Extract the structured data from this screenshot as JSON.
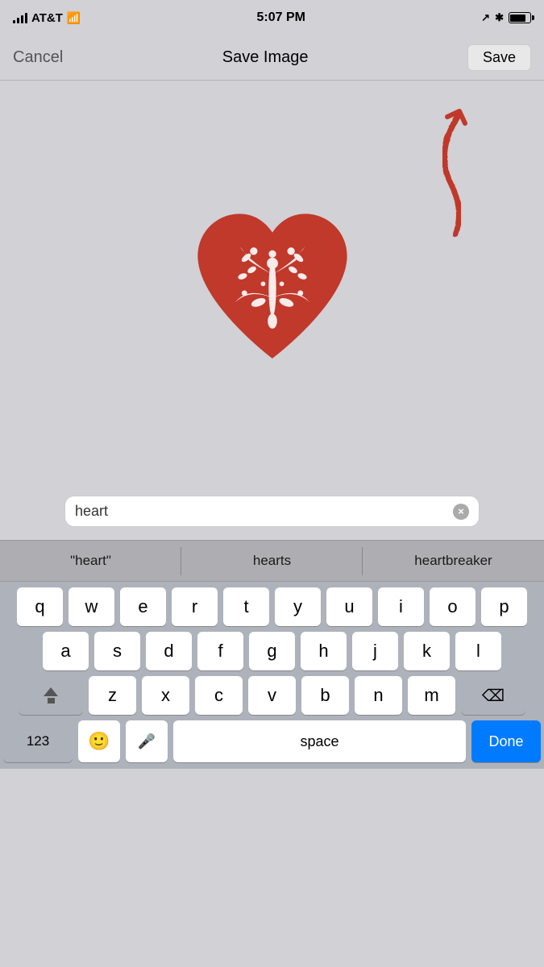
{
  "status_bar": {
    "carrier": "AT&T",
    "time": "5:07 PM",
    "icons": {
      "signal": "signal",
      "wifi": "wifi",
      "location": "location",
      "bluetooth": "bluetooth",
      "battery": "battery"
    }
  },
  "nav_bar": {
    "cancel_label": "Cancel",
    "title": "Save Image",
    "save_label": "Save"
  },
  "search": {
    "value": "heart",
    "clear_label": "×"
  },
  "suggestions": [
    {
      "id": "exact",
      "text": "\"heart\""
    },
    {
      "id": "hearts",
      "text": "hearts"
    },
    {
      "id": "heartbreaker",
      "text": "heartbreaker"
    }
  ],
  "keyboard": {
    "rows": [
      [
        "q",
        "w",
        "e",
        "r",
        "t",
        "y",
        "u",
        "i",
        "o",
        "p"
      ],
      [
        "a",
        "s",
        "d",
        "f",
        "g",
        "h",
        "j",
        "k",
        "l"
      ],
      [
        "z",
        "x",
        "c",
        "v",
        "b",
        "n",
        "m"
      ]
    ],
    "bottom": {
      "numbers_label": "123",
      "space_label": "space",
      "done_label": "Done"
    }
  }
}
